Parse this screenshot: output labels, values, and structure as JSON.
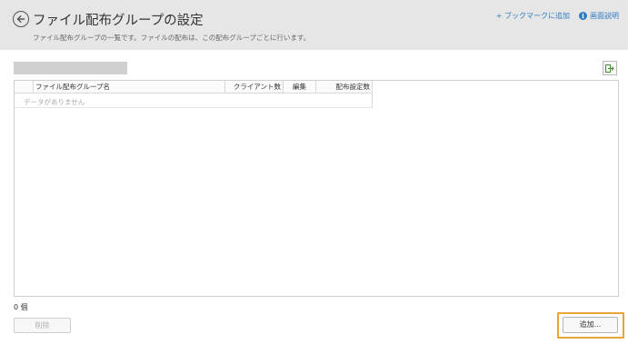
{
  "header": {
    "title": "ファイル配布グループの設定",
    "subtitle": "ファイル配布グループの一覧です。ファイルの配布は、この配布グループごとに行います。",
    "links": {
      "bookmark": "+ ブックマークに追加",
      "help": "画面説明"
    }
  },
  "toolbar": {
    "search_value": "",
    "export_icon": "export-icon"
  },
  "grid": {
    "columns": [
      "ファイル配布グループ名",
      "クライアント数",
      "編集",
      "配布設定数"
    ],
    "rows": [],
    "empty_text": "データがありません"
  },
  "footer": {
    "count_text": "0 個",
    "delete_label": "削除",
    "add_label": "追加..."
  },
  "colors": {
    "header_bg": "#e6e6e6",
    "link": "#2e7bc4",
    "highlight": "#eaa53a"
  }
}
